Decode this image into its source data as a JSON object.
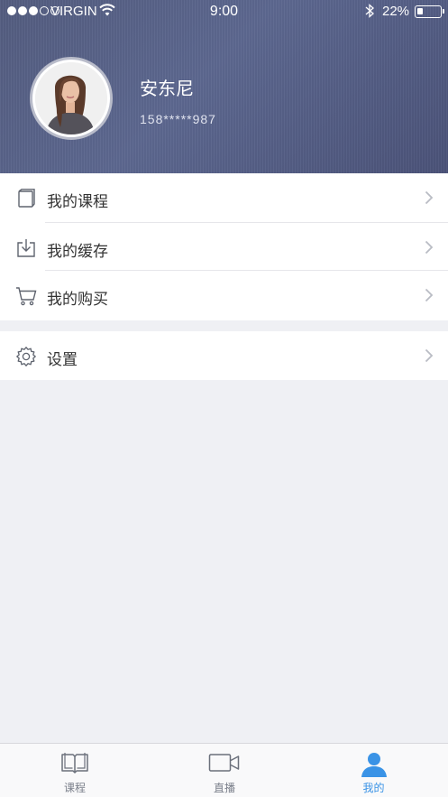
{
  "status_bar": {
    "carrier": "VIRGIN",
    "time": "9:00",
    "battery_percent": "22%",
    "battery_level": 0.22
  },
  "profile": {
    "name": "安东尼",
    "phone": "158*****987"
  },
  "menu": {
    "items": [
      {
        "label": "我的课程",
        "icon": "book-icon"
      },
      {
        "label": "我的缓存",
        "icon": "download-icon"
      },
      {
        "label": "我的购买",
        "icon": "cart-icon"
      }
    ],
    "settings": {
      "label": "设置",
      "icon": "gear-icon"
    }
  },
  "tabbar": {
    "tabs": [
      {
        "label": "课程",
        "icon": "open-book-icon",
        "active": false
      },
      {
        "label": "直播",
        "icon": "video-camera-icon",
        "active": false
      },
      {
        "label": "我的",
        "icon": "person-icon",
        "active": true
      }
    ]
  },
  "colors": {
    "accent": "#3a93e6",
    "header_bg": "#545d80",
    "page_bg": "#eff0f4"
  }
}
